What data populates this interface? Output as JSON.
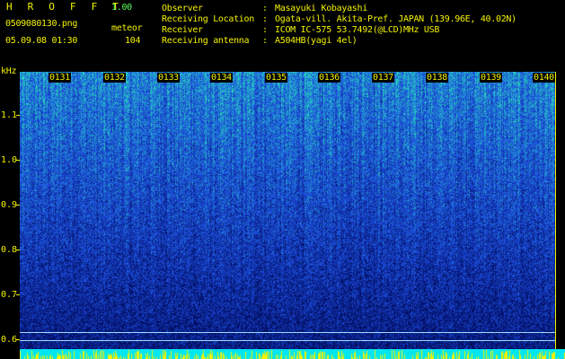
{
  "header": {
    "app_name": "H R O F F T",
    "version": "1.00",
    "file_name": "0509080130.png",
    "meteor_label": "meteor",
    "datetime": "05.09.08 01:30",
    "meteor_count": "104"
  },
  "info": [
    {
      "key": "Observer",
      "value": "Masayuki Kobayashi"
    },
    {
      "key": "Receiving Location",
      "value": "Ogata-vill. Akita-Pref. JAPAN (139.96E, 40.02N)"
    },
    {
      "key": "Receiver",
      "value": "ICOM IC-575 53.7492(@LCD)MHz USB"
    },
    {
      "key": "Receiving antenna",
      "value": "A504HB(yagi 4el)"
    }
  ],
  "info_separator": ":",
  "y_axis": {
    "unit": "kHz",
    "ticks": [
      "1.1",
      "1.0",
      "0.9",
      "0.8",
      "0.7",
      "0.6"
    ]
  },
  "x_axis": {
    "ticks": [
      "0131",
      "0132",
      "0133",
      "0134",
      "0135",
      "0136",
      "0137",
      "0138",
      "0139",
      "0140"
    ]
  },
  "colors": {
    "label_yellow": "#f2f200",
    "label_green": "#5cff5c",
    "background": "#000000",
    "spectrum_low": "#000a5a",
    "spectrum_mid": "#1e50e6",
    "spectrum_high": "#28e6b4",
    "reference_line": "#9fdcff",
    "level_bar": "#00e6f0"
  }
}
